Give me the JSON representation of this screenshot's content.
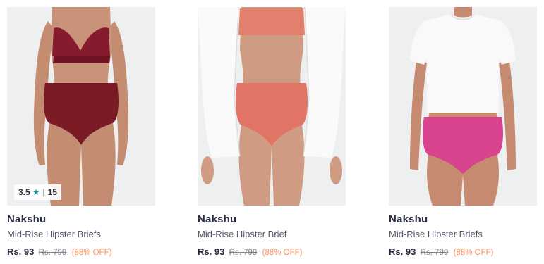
{
  "products": [
    {
      "image_alt": "Model wearing maroon mid-rise hipster briefs with lace bralette",
      "colors": {
        "brief": "#7b1b25",
        "top": "#861b2d"
      },
      "rating": {
        "score": "3.5",
        "star_icon": "star-icon",
        "count": "15"
      },
      "brand": "Nakshu",
      "name": "Mid-Rise Hipster Briefs",
      "price": "Rs. 93",
      "mrp": "Rs. 799",
      "discount": "(88% OFF)"
    },
    {
      "image_alt": "Model wearing coral mid-rise hipster brief with white shirt",
      "colors": {
        "brief": "#e27466",
        "top": "#e0806d"
      },
      "brand": "Nakshu",
      "name": "Mid-Rise Hipster Brief",
      "price": "Rs. 93",
      "mrp": "Rs. 799",
      "discount": "(88% OFF)"
    },
    {
      "image_alt": "Model wearing pink mid-rise hipster briefs with white tee",
      "colors": {
        "brief": "#d8438e",
        "top": "#f7f7f7"
      },
      "brand": "Nakshu",
      "name": "Mid-Rise Hipster Briefs",
      "price": "Rs. 93",
      "mrp": "Rs. 799",
      "discount": "(88% OFF)"
    }
  ]
}
